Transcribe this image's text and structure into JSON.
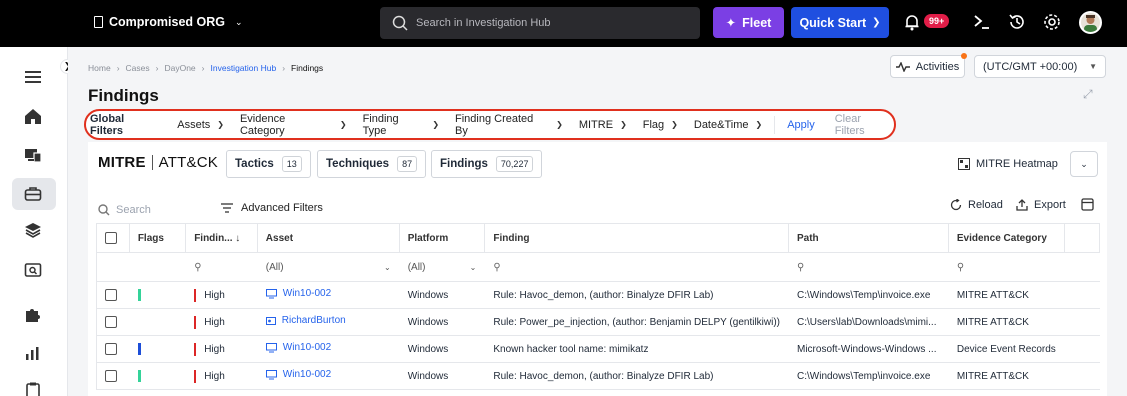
{
  "topbar": {
    "org_name": "Compromised ORG",
    "search_placeholder": "Search in Investigation Hub",
    "fleet_label": "Fleet",
    "quick_start_label": "Quick Start",
    "notifications_badge": "99+"
  },
  "breadcrumb": [
    "Home",
    "Cases",
    "DayOne",
    "Investigation Hub",
    "Findings"
  ],
  "page": {
    "title": "Findings",
    "activities_label": "Activities",
    "timezone": "(UTC/GMT +00:00)"
  },
  "global_filters": {
    "title": "Global Filters",
    "items": [
      "Assets",
      "Evidence Category",
      "Finding Type",
      "Finding Created By",
      "MITRE",
      "Flag",
      "Date&Time"
    ],
    "apply": "Apply",
    "clear": "Clear Filters"
  },
  "mitre": {
    "logo_left": "MITRE",
    "logo_right": "ATT&CK",
    "tabs": [
      {
        "label": "Tactics",
        "count": "13"
      },
      {
        "label": "Techniques",
        "count": "87"
      },
      {
        "label": "Findings",
        "count": "70,227"
      }
    ],
    "heatmap_label": "MITRE Heatmap"
  },
  "toolbar": {
    "search_placeholder": "Search",
    "advanced_filters": "Advanced Filters",
    "reload": "Reload",
    "export": "Export"
  },
  "table": {
    "columns": [
      "Flags",
      "Findin...",
      "Asset",
      "Platform",
      "Finding",
      "Path",
      "Evidence Category"
    ],
    "filter_all": "(All)",
    "rows": [
      {
        "flag_color": "#34d399",
        "severity": "High",
        "asset": "Win10-002",
        "asset_type": "computer",
        "platform": "Windows",
        "finding": "Rule: Havoc_demon, (author: Binalyze DFIR Lab)",
        "path": "C:\\Windows\\Temp\\invoice.exe",
        "category": "MITRE ATT&CK"
      },
      {
        "flag_color": "",
        "severity": "High",
        "asset": "RichardBurton",
        "asset_type": "user",
        "platform": "Windows",
        "finding": "Rule: Power_pe_injection, (author: Benjamin DELPY (gentilkiwi))",
        "path": "C:\\Users\\lab\\Downloads\\mimi...",
        "category": "MITRE ATT&CK"
      },
      {
        "flag_color": "#1d4ed8",
        "severity": "High",
        "asset": "Win10-002",
        "asset_type": "computer",
        "platform": "Windows",
        "finding": "Known hacker tool name: mimikatz",
        "path": "Microsoft-Windows-Windows ...",
        "category": "Device Event Records"
      },
      {
        "flag_color": "#34d399",
        "severity": "High",
        "asset": "Win10-002",
        "asset_type": "computer",
        "platform": "Windows",
        "finding": "Rule: Havoc_demon, (author: Binalyze DFIR Lab)",
        "path": "C:\\Windows\\Temp\\invoice.exe",
        "category": "MITRE ATT&CK"
      }
    ]
  }
}
